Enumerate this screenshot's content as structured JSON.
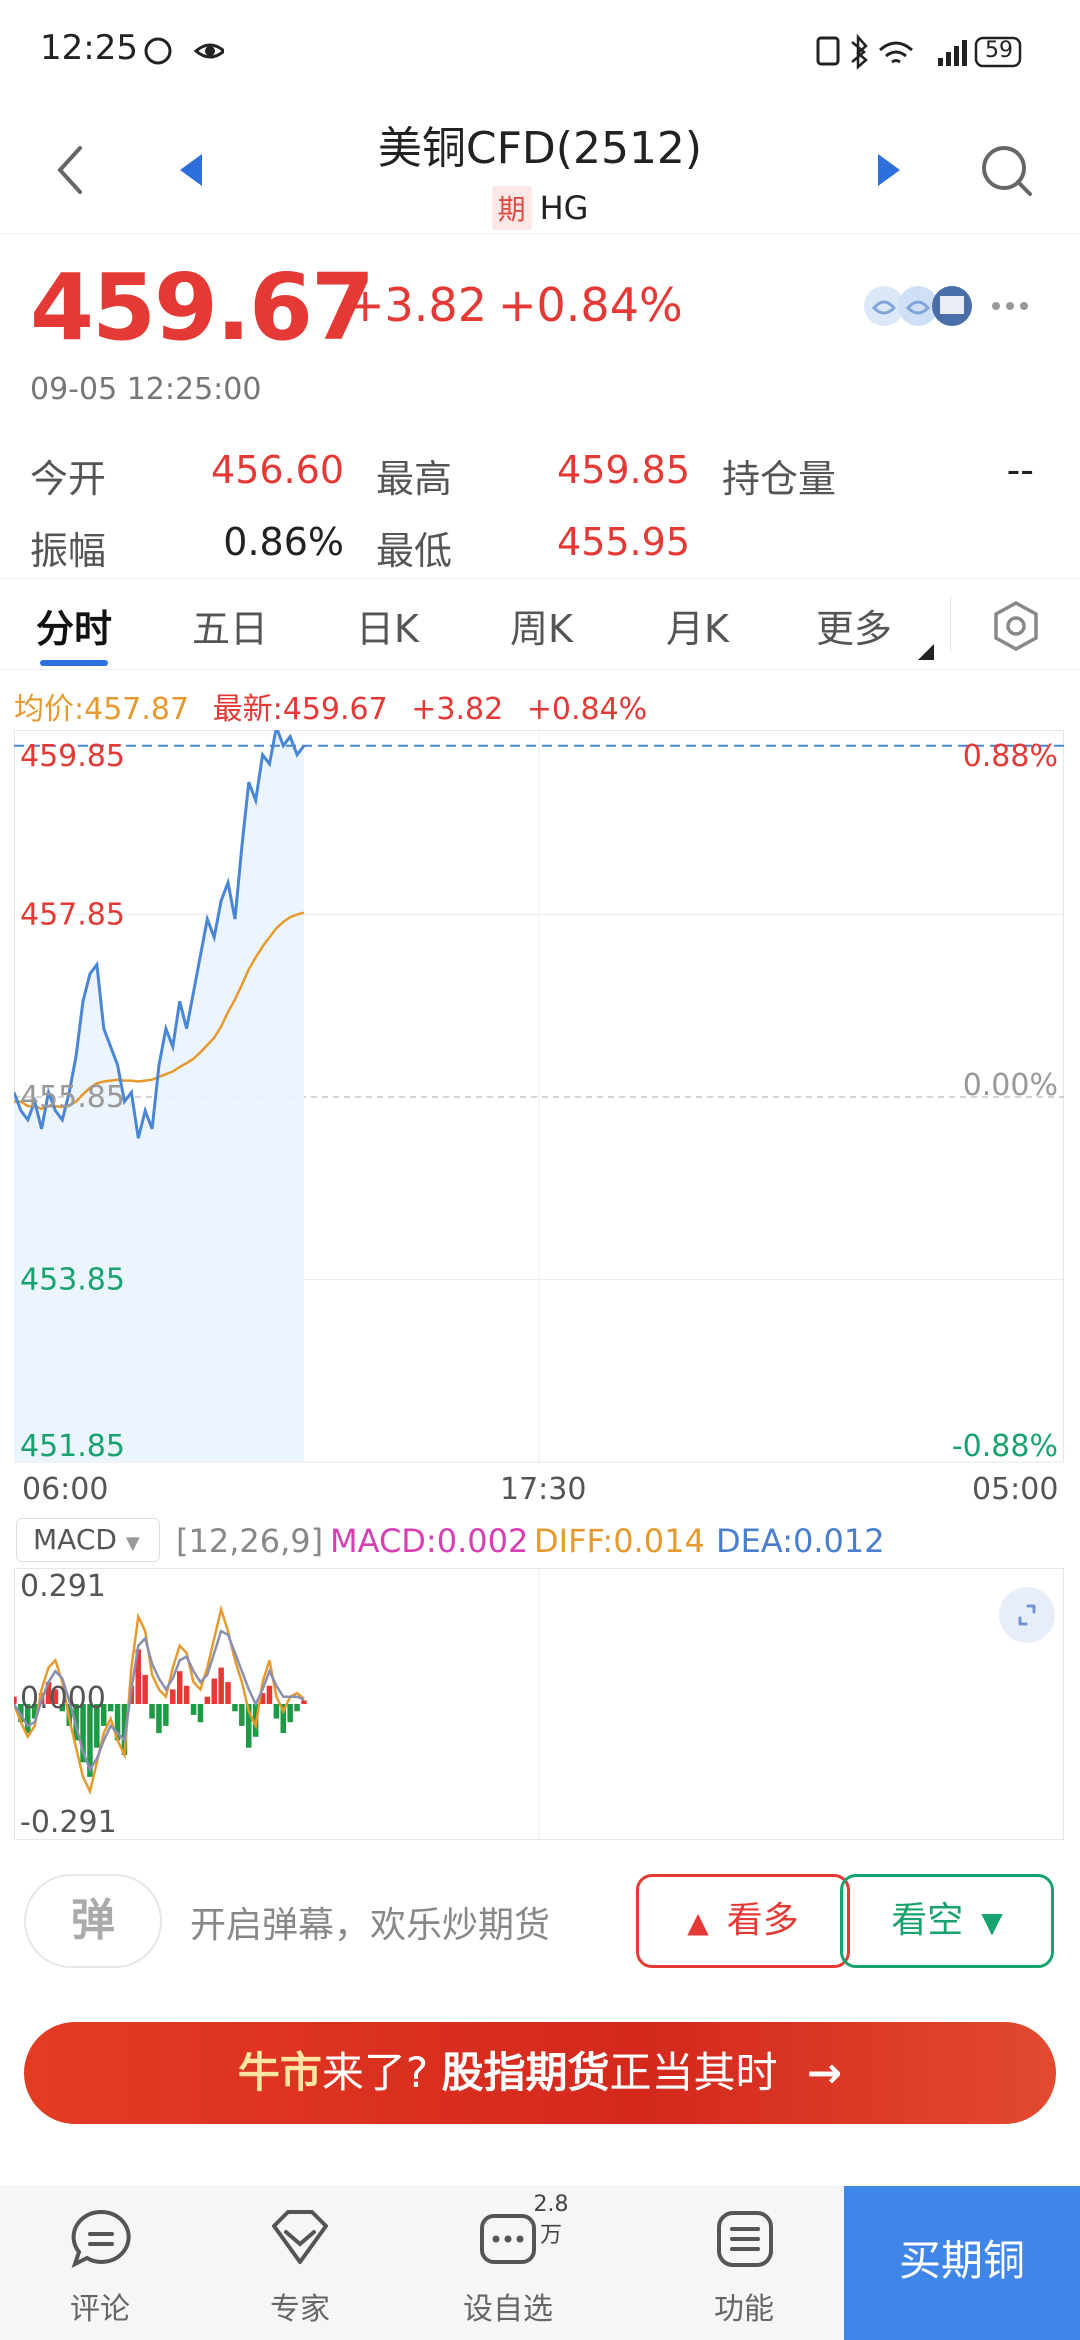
{
  "status": {
    "time": "12:25",
    "battery": "59",
    "network": "4G"
  },
  "nav": {
    "title": "美铜CFD(2512)",
    "tag": "期",
    "symbol": "HG"
  },
  "quote": {
    "price": "459.67",
    "change": "+3.82",
    "change_pct": "+0.84%",
    "time": "09-05 12:25:00",
    "stats": [
      {
        "label": "今开",
        "value": "456.60"
      },
      {
        "label": "最高",
        "value": "459.85"
      },
      {
        "label": "持仓量",
        "value": "--"
      },
      {
        "label": "振幅",
        "value": "0.86%"
      },
      {
        "label": "最低",
        "value": "455.95"
      }
    ]
  },
  "tabs": [
    "分时",
    "五日",
    "日K",
    "周K",
    "月K",
    "更多"
  ],
  "chart_header": {
    "avg": "均价:457.87",
    "latest": "最新:459.67",
    "change": "+3.82",
    "pct": "+0.84%"
  },
  "chart_data": {
    "type": "line",
    "y_left_labels": [
      "459.85",
      "457.85",
      "455.85",
      "453.85",
      "451.85"
    ],
    "y_right_labels": [
      "0.88%",
      "",
      "0.00%",
      "",
      "-0.88%"
    ],
    "x_labels": [
      "06:00",
      "17:30",
      "05:00"
    ],
    "ylim": [
      451.85,
      459.85
    ],
    "prev_close": 455.85,
    "series": [
      {
        "name": "最新",
        "values": [
          455.9,
          455.7,
          455.6,
          455.8,
          455.5,
          455.9,
          455.7,
          455.6,
          455.9,
          456.3,
          456.9,
          457.2,
          457.3,
          456.6,
          456.4,
          456.2,
          455.8,
          455.9,
          455.4,
          455.7,
          455.5,
          456.2,
          456.6,
          456.4,
          456.9,
          456.6,
          457.0,
          457.4,
          457.8,
          457.6,
          458.0,
          458.2,
          457.8,
          458.6,
          459.3,
          459.1,
          459.6,
          459.5,
          459.9,
          459.7,
          459.8,
          459.6,
          459.7
        ]
      },
      {
        "name": "均价",
        "values": [
          455.8,
          455.8,
          455.75,
          455.75,
          455.72,
          455.75,
          455.75,
          455.74,
          455.76,
          455.8,
          455.88,
          455.95,
          456.0,
          456.02,
          456.03,
          456.04,
          456.03,
          456.03,
          456.02,
          456.03,
          456.04,
          456.07,
          456.1,
          456.13,
          456.18,
          456.22,
          456.27,
          456.34,
          456.42,
          456.5,
          456.62,
          456.78,
          456.92,
          457.08,
          457.25,
          457.38,
          457.5,
          457.6,
          457.7,
          457.77,
          457.82,
          457.85,
          457.87
        ]
      }
    ]
  },
  "macd": {
    "selector": "MACD",
    "params": "[12,26,9]",
    "macd": "MACD:0.002",
    "diff": "DIFF:0.014",
    "dea": "DEA:0.012",
    "y_labels": [
      "0.291",
      "0.000",
      "-0.291"
    ],
    "ylim": [
      -0.291,
      0.291
    ],
    "bars": [
      0.02,
      -0.05,
      -0.08,
      -0.04,
      0.03,
      0.06,
      0.04,
      -0.02,
      -0.06,
      -0.1,
      -0.16,
      -0.2,
      -0.12,
      -0.06,
      -0.02,
      -0.1,
      -0.14,
      0.05,
      0.15,
      0.08,
      -0.04,
      -0.08,
      -0.06,
      0.04,
      0.09,
      0.05,
      -0.03,
      -0.05,
      0.02,
      0.07,
      0.1,
      0.06,
      -0.02,
      -0.06,
      -0.12,
      -0.09,
      0.03,
      0.05,
      -0.04,
      -0.08,
      -0.05,
      -0.02,
      0.01
    ],
    "diff_values": [
      0.0,
      -0.05,
      -0.09,
      -0.06,
      0.04,
      0.1,
      0.12,
      0.06,
      -0.04,
      -0.12,
      -0.2,
      -0.24,
      -0.16,
      -0.08,
      -0.04,
      -0.1,
      -0.14,
      0.1,
      0.24,
      0.2,
      0.08,
      0.04,
      0.02,
      0.1,
      0.16,
      0.14,
      0.06,
      0.04,
      0.1,
      0.18,
      0.26,
      0.2,
      0.12,
      0.06,
      -0.02,
      -0.06,
      0.06,
      0.12,
      0.02,
      -0.02,
      0.02,
      0.03,
      0.014
    ],
    "dea_values": [
      0.0,
      -0.03,
      -0.06,
      -0.05,
      0.01,
      0.06,
      0.09,
      0.07,
      0.01,
      -0.06,
      -0.13,
      -0.18,
      -0.15,
      -0.1,
      -0.06,
      -0.08,
      -0.1,
      0.04,
      0.16,
      0.18,
      0.11,
      0.07,
      0.04,
      0.07,
      0.12,
      0.13,
      0.09,
      0.06,
      0.08,
      0.14,
      0.2,
      0.19,
      0.14,
      0.09,
      0.04,
      0.0,
      0.04,
      0.09,
      0.05,
      0.02,
      0.02,
      0.02,
      0.012
    ]
  },
  "action": {
    "danmu_btn": "弹",
    "danmu_text": "开启弹幕，欢乐炒期货",
    "bull": "看多",
    "bear": "看空"
  },
  "banner": {
    "p1": "牛市",
    "p2": "来了?",
    "p3": "股指期货",
    "p4": "正当其时"
  },
  "bottom_nav": {
    "items": [
      "评论",
      "专家",
      "设自选",
      "功能"
    ],
    "badge": "2.8万",
    "buy": "买期铜"
  },
  "colors": {
    "up": "#e53935",
    "down": "#18a36e",
    "accent": "#2d6fdc",
    "avg": "#e69a2e"
  }
}
